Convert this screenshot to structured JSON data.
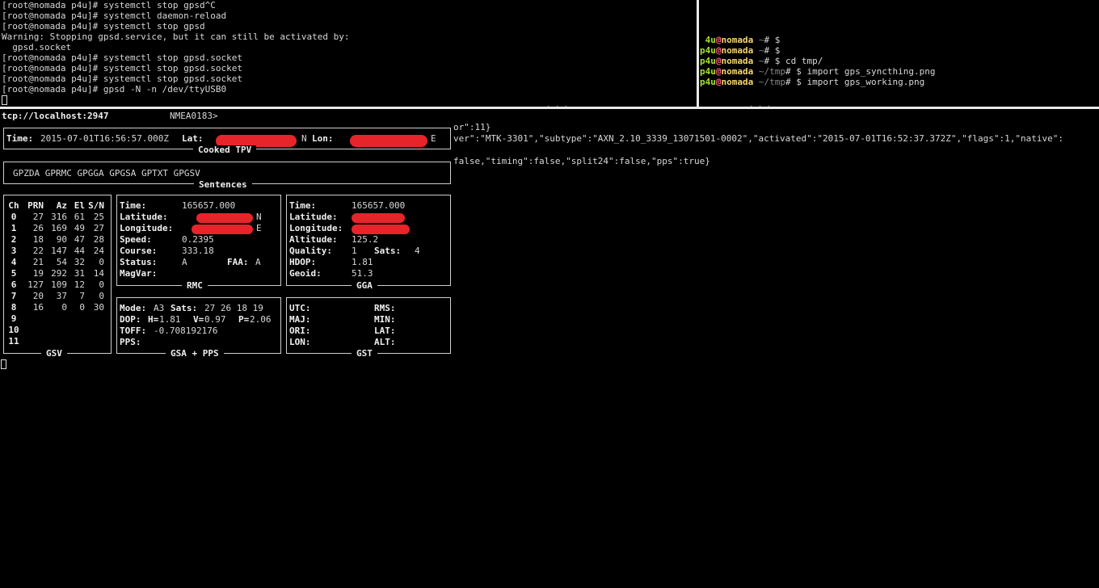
{
  "top_left": {
    "lines": [
      "[root@nomada p4u]# systemctl stop gpsd^C",
      "[root@nomada p4u]# systemctl daemon-reload",
      "[root@nomada p4u]# systemctl stop gpsd",
      "Warning: Stopping gpsd.service, but it can still be activated by:",
      "  gpsd.socket",
      "[root@nomada p4u]# systemctl stop gpsd.socket",
      "[root@nomada p4u]# systemctl stop gpsd.socket",
      "[root@nomada p4u]# systemctl stop gpsd.socket",
      "[root@nomada p4u]# gpsd -N -n /dev/ttyUSB0"
    ]
  },
  "top_right": {
    "prompts": [
      {
        "user": " 4u",
        "at": "@",
        "host": "nomada",
        "path": " ~",
        "sym": "# ",
        "cmd": "$"
      },
      {
        "user": "p4u",
        "at": "@",
        "host": "nomada",
        "path": " ~",
        "sym": "# ",
        "cmd": "$"
      },
      {
        "user": "p4u",
        "at": "@",
        "host": "nomada",
        "path": " ~",
        "sym": "# ",
        "cmd": "$ cd tmp/"
      },
      {
        "user": "p4u",
        "at": "@",
        "host": "nomada",
        "path": " ~/tmp",
        "sym": "# ",
        "cmd": "$ import gps_syncthing.png"
      },
      {
        "user": "p4u",
        "at": "@",
        "host": "nomada",
        "path": " ~/tmp",
        "sym": "# ",
        "cmd": "$ import gps_working.png"
      }
    ]
  },
  "gpsmon": {
    "host": "tcp://localhost:2947",
    "driver": "NMEA0183>",
    "tpv": {
      "title": "Cooked TPV",
      "time_label": "Time:",
      "time": "2015-07-01T16:56:57.000Z",
      "lat_label": "Lat:",
      "lat_hemi": "N",
      "lon_label": "Lon:",
      "lon_hemi": "E"
    },
    "sentences": {
      "title": "Sentences",
      "list": "GPZDA GPRMC GPGGA GPGSA GPTXT GPGSV"
    },
    "gsv": {
      "title": "GSV",
      "headers": [
        "Ch",
        "PRN",
        "Az",
        "El",
        "S/N"
      ],
      "rows": [
        [
          "0",
          "27",
          "316",
          "61",
          "25"
        ],
        [
          "1",
          "26",
          "169",
          "49",
          "27"
        ],
        [
          "2",
          "18",
          "90",
          "47",
          "28"
        ],
        [
          "3",
          "22",
          "147",
          "44",
          "24"
        ],
        [
          "4",
          "21",
          "54",
          "32",
          "0"
        ],
        [
          "5",
          "19",
          "292",
          "31",
          "14"
        ],
        [
          "6",
          "127",
          "109",
          "12",
          "0"
        ],
        [
          "7",
          "20",
          "37",
          "7",
          "0"
        ],
        [
          "8",
          "16",
          "0",
          "0",
          "30"
        ],
        [
          "9",
          "",
          "",
          "",
          ""
        ],
        [
          "10",
          "",
          "",
          "",
          ""
        ],
        [
          "11",
          "",
          "",
          "",
          ""
        ]
      ]
    },
    "rmc": {
      "title": "RMC",
      "time_label": "Time:",
      "time": "165657.000",
      "lat_label": "Latitude:",
      "lat_hemi": "N",
      "lon_label": "Longitude:",
      "lon_hemi": "E",
      "speed_label": "Speed:",
      "speed": "0.2395",
      "course_label": "Course:",
      "course": "333.18",
      "status_label": "Status:",
      "status": "A",
      "faa_label": "FAA:",
      "faa": "A",
      "magvar_label": "MagVar:"
    },
    "gga": {
      "title": "GGA",
      "time_label": "Time:",
      "time": "165657.000",
      "lat_label": "Latitude:",
      "lon_label": "Longitude:",
      "alt_label": "Altitude:",
      "alt": "125.2",
      "quality_label": "Quality:",
      "quality": "1",
      "sats_label": "Sats:",
      "sats": "4",
      "hdop_label": "HDOP:",
      "hdop": "1.81",
      "geoid_label": "Geoid:",
      "geoid": "51.3"
    },
    "gsa": {
      "title": "GSA + PPS",
      "mode_label": "Mode:",
      "mode": "A3",
      "sats_label": "Sats:",
      "sats": "27 26 18 19",
      "dop_label": "DOP:",
      "h_label": "H=",
      "h": "1.81",
      "v_label": "V=",
      "v": "0.97",
      "p_label": "P=",
      "p": "2.06",
      "toff_label": "TOFF:",
      "toff": "-0.708192176",
      "pps_label": "PPS:"
    },
    "gst": {
      "title": "GST",
      "utc": "UTC:",
      "rms": "RMS:",
      "maj": "MAJ:",
      "min": "MIN:",
      "ori": "ORI:",
      "lat": "LAT:",
      "lon": "LON:",
      "alt": "ALT:"
    },
    "json_lines": [
      "or\":11}",
      "ver\":\"MTK-3301\",\"subtype\":\"AXN_2.10_3339_13071501-0002\",\"activated\":\"2015-07-01T16:52:37.372Z\",\"flags\":1,\"native\":",
      "",
      "false,\"timing\":false,\"split24\":false,\"pps\":true}"
    ]
  },
  "colors": {
    "user": "#a6e22e",
    "at": "#ff5f87",
    "host": "#f5d76e",
    "redaction": "#e8242b"
  }
}
